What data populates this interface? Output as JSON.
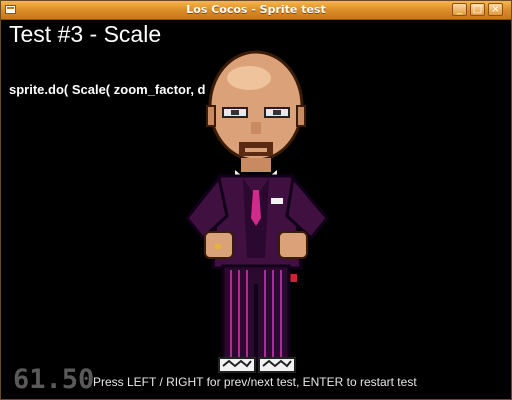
{
  "window": {
    "title": "Los Cocos - Sprite test",
    "buttons": {
      "minimize": "_",
      "maximize": "□",
      "close": "×"
    }
  },
  "canvas": {
    "heading": "Test #3 - Scale",
    "code_line": "sprite.do( Scale( zoom_factor, d",
    "fps": "61.50",
    "hint": "Press LEFT / RIGHT for prev/next test, ENTER to restart test"
  },
  "colors": {
    "titlebar": "#e39a3b",
    "canvas_bg": "#000000",
    "suit": "#3f1040",
    "skin": "#dba27a",
    "fps_text": "#5a5a5a"
  }
}
